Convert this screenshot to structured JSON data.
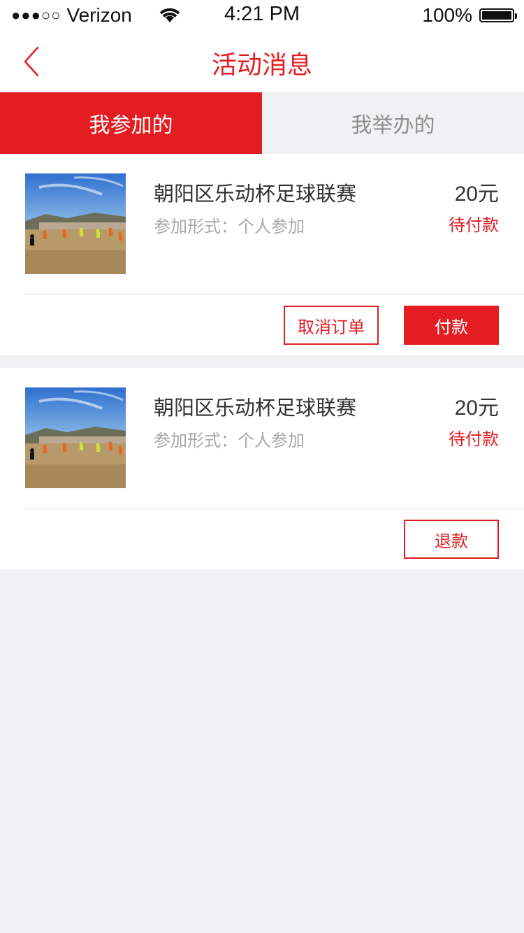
{
  "status_bar": {
    "carrier": "Verizon",
    "time": "4:21 PM",
    "battery": "100%"
  },
  "nav": {
    "title": "活动消息",
    "back_icon": "chevron-left-icon"
  },
  "tabs": [
    {
      "label": "我参加的",
      "active": true
    },
    {
      "label": "我举办的",
      "active": false
    }
  ],
  "orders": [
    {
      "title": "朝阳区乐动杯足球联赛",
      "form_label": "参加形式：",
      "form_value": "个人参加",
      "price": "20元",
      "status": "待付款",
      "actions": [
        {
          "label": "取消订单",
          "style": "outline"
        },
        {
          "label": "付款",
          "style": "filled"
        }
      ]
    },
    {
      "title": "朝阳区乐动杯足球联赛",
      "form_label": "参加形式：",
      "form_value": "个人参加",
      "price": "20元",
      "status": "待付款",
      "actions": [
        {
          "label": "退款",
          "style": "outline"
        }
      ]
    }
  ],
  "colors": {
    "accent": "#e31d21",
    "background": "#f0f1f3"
  }
}
